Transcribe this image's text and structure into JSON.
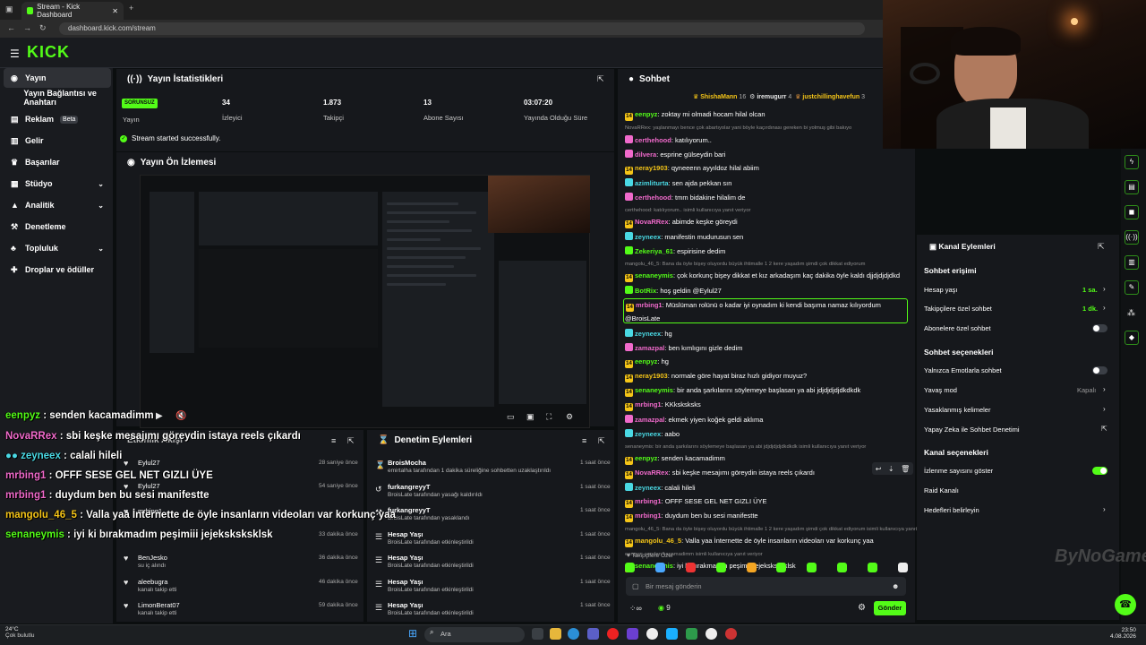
{
  "browser": {
    "tab_title": "Stream - Kick Dashboard",
    "url": "dashboard.kick.com/stream"
  },
  "brand": {
    "logo": "KICK",
    "accent": "#53fc18"
  },
  "sidebar": {
    "items": [
      {
        "label": "Yayın",
        "icon": "broadcast-icon"
      },
      {
        "label": "Yayın Bağlantısı ve Anahtarı",
        "icon": "key-icon"
      },
      {
        "label": "Reklam",
        "icon": "ad-icon",
        "badge": "Beta"
      },
      {
        "label": "Gelir",
        "icon": "money-icon"
      },
      {
        "label": "Başarılar",
        "icon": "trophy-icon"
      },
      {
        "label": "Stüdyo",
        "icon": "studio-icon"
      },
      {
        "label": "Analitik",
        "icon": "chart-icon"
      },
      {
        "label": "Denetleme",
        "icon": "hammer-icon"
      },
      {
        "label": "Topluluk",
        "icon": "community-icon"
      },
      {
        "label": "Droplar ve ödüller",
        "icon": "gift-icon"
      }
    ]
  },
  "stats": {
    "title": "Yayın İstatistikleri",
    "status": "SORUNSUZ",
    "items": [
      {
        "label": "Yayın",
        "value": ""
      },
      {
        "label": "İzleyici",
        "value": "34"
      },
      {
        "label": "Takipçi",
        "value": "1.873"
      },
      {
        "label": "Abone Sayısı",
        "value": "13"
      },
      {
        "label": "Yayında Olduğu Süre",
        "value": "03:07:20"
      }
    ],
    "success": "Stream started successfully."
  },
  "preview": {
    "title": "Yayın Ön İzlemesi"
  },
  "activity": {
    "title": "Etkinlik Akışı",
    "rows": [
      {
        "name": "Eylul27",
        "sub": "",
        "time": "28 saniye önce"
      },
      {
        "name": "Eylul27",
        "sub": "",
        "time": "54 saniye önce"
      },
      {
        "name": "mrbing1",
        "sub": "",
        "time": ""
      },
      {
        "name": "",
        "sub": "",
        "time": "33 dakika önce"
      },
      {
        "name": "BenJesko",
        "sub": "su iç alındı",
        "time": "36 dakika önce"
      },
      {
        "name": "aleebugra",
        "sub": "kanalı takip etti",
        "time": "46 dakika önce"
      },
      {
        "name": "LimonBerat07",
        "sub": "kanalı takip etti",
        "time": "59 dakika önce"
      }
    ]
  },
  "moderation": {
    "title": "Denetim Eylemleri",
    "rows": [
      {
        "title": "BroisMocha",
        "sub": "emirtalha tarafından 1 dakika süreliğine sohbetten uzaklaştırıldı",
        "time": "1 saat önce"
      },
      {
        "title": "furkangreyyT",
        "sub": "BroisLate tarafından yasağı kaldırıldı",
        "time": "1 saat önce"
      },
      {
        "title": "furkangreyyT",
        "sub": "BroisLate tarafından yasaklandı",
        "time": "1 saat önce"
      },
      {
        "title": "Hesap Yaşı",
        "sub": "BroisLate tarafından etkinleştirildi",
        "time": "1 saat önce"
      },
      {
        "title": "Hesap Yaşı",
        "sub": "BroisLate tarafından etkinleştirildi",
        "time": "1 saat önce"
      },
      {
        "title": "Hesap Yaşı",
        "sub": "BroisLate tarafından etkinleştirildi",
        "time": "1 saat önce"
      },
      {
        "title": "Hesap Yaşı",
        "sub": "BroisLate tarafından etkinleştirildi",
        "time": "1 saat önce"
      }
    ]
  },
  "chat": {
    "title": "Sohbet",
    "top_gifters": [
      {
        "name": "ShishaMann",
        "count": "16"
      },
      {
        "name": "iremugurr",
        "count": "4"
      },
      {
        "name": "justchillinghavefun",
        "count": "3"
      }
    ],
    "messages": [
      {
        "type": "msg",
        "badge": "sub",
        "user": "eenpyz",
        "ucolor": "#53fc18",
        "text": "zoktay mi olmadi hocam hilal olcan"
      },
      {
        "type": "sys",
        "text": "NovaRRex: yaşlanmayı bence çok abartıyolar yani böyle kaçırdınası gereken bi yolmuş gibi bakıyo"
      },
      {
        "type": "msg",
        "badge": "pink",
        "user": "certhehood",
        "ucolor": "#f06acb",
        "text": "katılıyorum.."
      },
      {
        "type": "msg",
        "badge": "pink",
        "user": "dilvera",
        "ucolor": "#f06acb",
        "text": "esprine gülseydin bari"
      },
      {
        "type": "msg",
        "badge": "sub",
        "user": "neray1903",
        "ucolor": "#f5c518",
        "text": "qyneeenn ayyıldoz hilal abiim"
      },
      {
        "type": "msg",
        "badge": "cyan",
        "user": "azimliturta",
        "ucolor": "#4ad9e4",
        "text": "sen ajda pekkan sın"
      },
      {
        "type": "msg",
        "badge": "pink",
        "user": "certhehood",
        "ucolor": "#f06acb",
        "text": "tmm bidakine hilalim de"
      },
      {
        "type": "sys",
        "text": "certhehood: katılıyorum.. isimli kullanıcıya yanıt veriyor"
      },
      {
        "type": "msg",
        "badge": "sub",
        "user": "NovaRRex",
        "ucolor": "#f06acb",
        "text": "abimde keşke göreydi"
      },
      {
        "type": "msg",
        "badge": "cyan",
        "user": "zeyneex",
        "ucolor": "#4ad9e4",
        "text": "manifestin mudurusun sen"
      },
      {
        "type": "msg",
        "badge": "green",
        "user": "Zekeriya_61",
        "ucolor": "#53fc18",
        "text": "espirisine dedim"
      },
      {
        "type": "sys",
        "text": "mangolu_46_5: Bana da öyle bişey oluyordu büyük ihtimalle 1 2 kere yaşadım şimdi çok dikkat ediyorum"
      },
      {
        "type": "msg",
        "badge": "sub",
        "user": "senaneymis",
        "ucolor": "#53fc18",
        "text": "çok korkunç bişey dikkat et kız arkadaşım kaç dakika öyle kaldı djjdjdjdjdkd"
      },
      {
        "type": "msg",
        "badge": "green",
        "user": "BotRix",
        "ucolor": "#53fc18",
        "text": "hoş geldin @Eylul27"
      },
      {
        "type": "msg",
        "badge": "sub",
        "user": "mrbing1",
        "ucolor": "#f06acb",
        "text": "Müslüman rolünü o kadar iyi oynadım ki kendi başıma namaz kılıyordum"
      },
      {
        "type": "cont",
        "text": "@BroisLate"
      },
      {
        "type": "msg",
        "badge": "cyan",
        "user": "zeyneex",
        "ucolor": "#4ad9e4",
        "text": "hg"
      },
      {
        "type": "msg",
        "badge": "pink",
        "user": "zamazpal",
        "ucolor": "#f06acb",
        "text": "ben kımlıgını gizle dedim"
      },
      {
        "type": "msg",
        "badge": "sub",
        "user": "eenpyz",
        "ucolor": "#53fc18",
        "text": "hg"
      },
      {
        "type": "msg",
        "badge": "sub",
        "user": "neray1903",
        "ucolor": "#f5c518",
        "text": "normale göre hayat biraz hızlı gidiyor muyuz?"
      },
      {
        "type": "msg",
        "badge": "sub",
        "user": "senaneymis",
        "ucolor": "#53fc18",
        "text": "bir anda şarkılarını söylemeye başlasan ya abi jdjdjdjdjdkdkdk"
      },
      {
        "type": "msg",
        "badge": "sub",
        "user": "mrbing1",
        "ucolor": "#f06acb",
        "text": "KKksksksks"
      },
      {
        "type": "msg",
        "badge": "pink",
        "user": "zamazpal",
        "ucolor": "#f06acb",
        "text": "ekmek yiyen koğek geldi aklıma"
      },
      {
        "type": "msg",
        "badge": "cyan",
        "user": "zeyneex",
        "ucolor": "#4ad9e4",
        "text": "aabo"
      },
      {
        "type": "sys",
        "text": "senaneymis: bir anda şarkılarını söylemeye başlasan ya abi jdjdjdjdjdkdkdk isimli kullanıcıya yanıt veriyor"
      },
      {
        "type": "msg",
        "badge": "sub",
        "user": "eenpyz",
        "ucolor": "#53fc18",
        "text": "senden kacamadimm"
      },
      {
        "type": "msg",
        "badge": "sub",
        "user": "NovaRRex",
        "ucolor": "#f06acb",
        "text": "sbi keşke mesajımı göreydin istaya reels çıkardı"
      },
      {
        "type": "msg",
        "badge": "cyan",
        "user": "zeyneex",
        "ucolor": "#4ad9e4",
        "text": "calali hileli"
      },
      {
        "type": "msg",
        "badge": "sub",
        "user": "mrbing1",
        "ucolor": "#f06acb",
        "text": "OFFF SESE GEL NET GIZLI ÜYE"
      },
      {
        "type": "msg",
        "badge": "sub",
        "user": "mrbing1",
        "ucolor": "#f06acb",
        "text": "duydum ben bu sesi manifestte"
      },
      {
        "type": "sys",
        "text": "mangolu_46_5: Bana da öyle bişey oluyordu büyük ihtimalle 1 2 kere yaşadım şimdi çok dikkat ediyorum isimli kullanıcıya yanıt veriyor"
      },
      {
        "type": "msg",
        "badge": "sub",
        "user": "mangolu_46_5",
        "ucolor": "#f5c518",
        "text": "Valla yaa İnternette de öyle insanların videoları var korkunç yaa"
      },
      {
        "type": "sys",
        "text": "eenpyz: senden kacamadimm isimli kullanıcıya yanıt veriyor"
      },
      {
        "type": "msg",
        "badge": "sub",
        "user": "senaneymis",
        "ucolor": "#53fc18",
        "text": "iyi ki bırakmadım peşimiii jejeksksksklsk"
      }
    ],
    "followers_only": "Takipçilere Özel",
    "input_placeholder": "Bir mesaj gönderin",
    "send_label": "Gönder",
    "points": "9"
  },
  "channel_actions": {
    "title": "Kanal Eylemleri",
    "chat_access": {
      "title": "Sohbet erişimi",
      "rows": [
        {
          "label": "Hesap yaşı",
          "value": "1 sa."
        },
        {
          "label": "Takipçilere özel sohbet",
          "value": "1 dk."
        },
        {
          "label": "Abonelere özel sohbet",
          "value": ""
        }
      ]
    },
    "chat_options": {
      "title": "Sohbet seçenekleri",
      "rows": [
        {
          "label": "Yalnızca Emotlarla sohbet",
          "value": ""
        },
        {
          "label": "Yavaş mod",
          "value": "Kapalı"
        },
        {
          "label": "Yasaklanmış kelimeler",
          "value": ""
        },
        {
          "label": "Yapay Zeka ile Sohbet Denetimi",
          "value": ""
        }
      ]
    },
    "channel_options": {
      "title": "Kanal seçenekleri",
      "rows": [
        {
          "label": "İzlenme sayısını göster",
          "value": ""
        },
        {
          "label": "Raid Kanalı",
          "value": ""
        },
        {
          "label": "Hedefleri belirleyin",
          "value": ""
        }
      ]
    }
  },
  "overlay_chat": [
    {
      "user": "eenpyz",
      "color": "#53fc18",
      "text": "senden kacamadimm"
    },
    {
      "user": "NovaRRex",
      "color": "#f06acb",
      "text": "sbi keşke mesajımı göreydin istaya reels çıkardı"
    },
    {
      "user": "zeyneex",
      "color": "#4ad9e4",
      "text": "calali hileli"
    },
    {
      "user": "mrbing1",
      "color": "#f06acb",
      "text": "OFFF SESE GEL NET GIZLI ÜYE"
    },
    {
      "user": "mrbing1",
      "color": "#f06acb",
      "text": "duydum ben bu sesi manifestte"
    },
    {
      "user": "mangolu_46_5",
      "color": "#f5c518",
      "text": "Valla yaa İnternette de öyle insanların videoları var korkunç yaa"
    },
    {
      "user": "senaneymis",
      "color": "#53fc18",
      "text": "iyi ki bırakmadım peşimiii jejeksksksklsk"
    }
  ],
  "watermark": "ByNoGame",
  "taskbar": {
    "weather_temp": "24°C",
    "weather_text": "Çok bulutlu",
    "search": "Ara",
    "time": "23:50",
    "date": "4.08.2026"
  }
}
